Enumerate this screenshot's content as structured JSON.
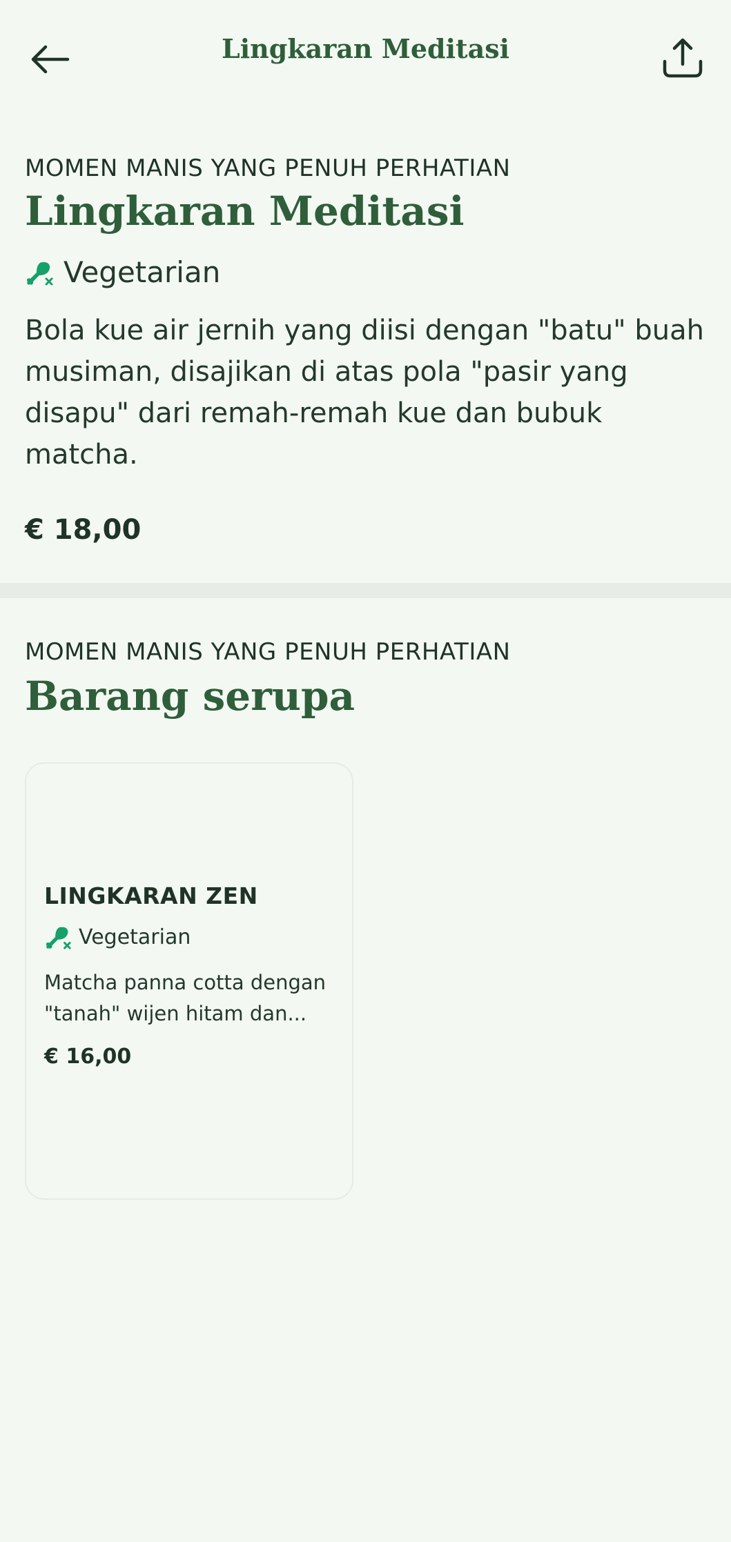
{
  "header": {
    "title": "Lingkaran Meditasi",
    "back_icon": "arrow-left-icon",
    "share_icon": "share-icon"
  },
  "item": {
    "category": "MOMEN MANIS YANG PENUH PERHATIAN",
    "name": "Lingkaran Meditasi",
    "diet": "Vegetarian",
    "diet_icon": "drumstick-crossed-icon",
    "description": "Bola kue air jernih yang diisi dengan \"batu\" buah musiman, disajikan di atas pola \"pasir yang disapu\" dari remah-remah kue dan bubuk matcha.",
    "price": "€ 18,00"
  },
  "similar": {
    "category": "MOMEN MANIS YANG PENUH PERHATIAN",
    "title": "Barang serupa",
    "items": [
      {
        "name": "LINGKARAN ZEN",
        "diet": "Vegetarian",
        "description": "Matcha panna cotta dengan \"tanah\" wijen hitam dan...",
        "price": "€ 16,00"
      }
    ]
  },
  "colors": {
    "background": "#f3f8f2",
    "accent_green": "#2f5e3a",
    "icon_green": "#16a06a",
    "text": "#1f3326"
  }
}
